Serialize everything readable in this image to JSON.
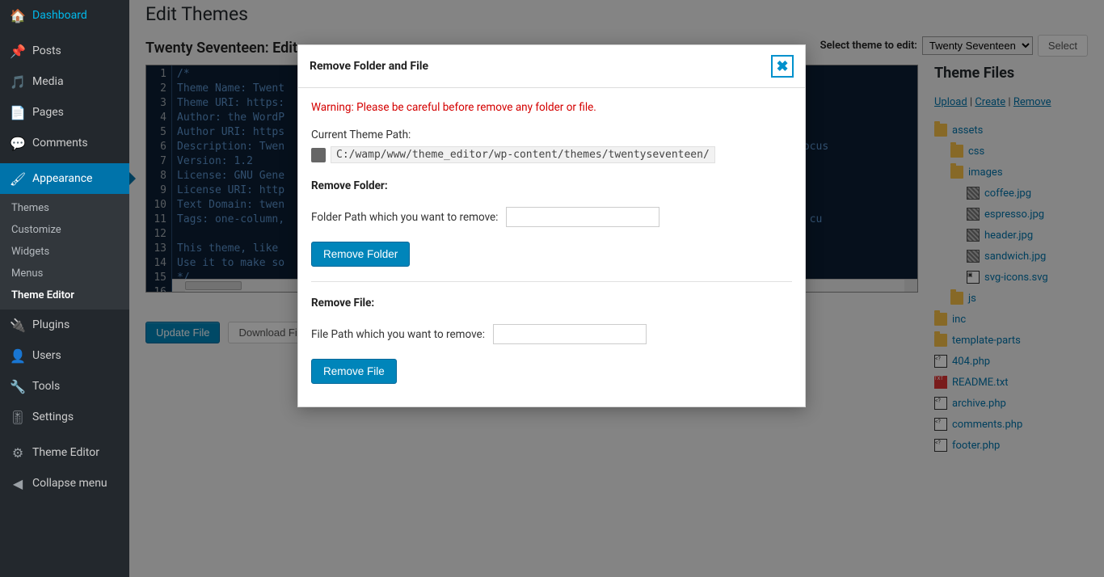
{
  "sidebar": {
    "items": [
      {
        "label": "Dashboard",
        "icon": "dashboard"
      },
      {
        "label": "Posts",
        "icon": "pin"
      },
      {
        "label": "Media",
        "icon": "media"
      },
      {
        "label": "Pages",
        "icon": "page"
      },
      {
        "label": "Comments",
        "icon": "comment"
      },
      {
        "label": "Appearance",
        "icon": "brush",
        "current": true
      },
      {
        "label": "Plugins",
        "icon": "plug"
      },
      {
        "label": "Users",
        "icon": "user"
      },
      {
        "label": "Tools",
        "icon": "wrench"
      },
      {
        "label": "Settings",
        "icon": "sliders"
      },
      {
        "label": "Theme Editor",
        "icon": "gear"
      },
      {
        "label": "Collapse menu",
        "icon": "collapse"
      }
    ],
    "appearance_sub": [
      "Themes",
      "Customize",
      "Widgets",
      "Menus",
      "Theme Editor"
    ],
    "appearance_active": "Theme Editor"
  },
  "page": {
    "title": "Edit Themes",
    "subtitle": "Twenty Seventeen: Edit",
    "select_label": "Select theme to edit:",
    "select_value": "Twenty Seventeen",
    "select_btn": "Select"
  },
  "code": {
    "lines": [
      "/*",
      "Theme Name: Twent",
      "Theme URI: https:",
      "Author: the WordP",
      "Author URI: https",
      "Description: Twen                                                                  images. With a focus",
      "Version: 1.2",
      "License: GNU Gene",
      "License URI: http",
      "Text Domain: twen",
      "Tags: one-column,                                                                  , custom-header, cu",
      "",
      "This theme, like ",
      "Use it to make so",
      "*/",
      ""
    ]
  },
  "actions": {
    "update": "Update File",
    "download": "Download File"
  },
  "files": {
    "heading": "Theme Files",
    "links": {
      "upload": "Upload",
      "create": "Create",
      "remove": "Remove",
      "sep": " | "
    },
    "tree": [
      {
        "type": "folder",
        "label": "assets",
        "indent": 0
      },
      {
        "type": "folder",
        "label": "css",
        "indent": 1
      },
      {
        "type": "folder",
        "label": "images",
        "indent": 1
      },
      {
        "type": "img",
        "label": "coffee.jpg",
        "indent": 2
      },
      {
        "type": "img",
        "label": "espresso.jpg",
        "indent": 2
      },
      {
        "type": "img",
        "label": "header.jpg",
        "indent": 2
      },
      {
        "type": "img",
        "label": "sandwich.jpg",
        "indent": 2
      },
      {
        "type": "svg",
        "label": "svg-icons.svg",
        "indent": 2
      },
      {
        "type": "folder",
        "label": "js",
        "indent": 1
      },
      {
        "type": "folder",
        "label": "inc",
        "indent": 0
      },
      {
        "type": "folder",
        "label": "template-parts",
        "indent": 0
      },
      {
        "type": "php",
        "label": "404.php",
        "indent": 0
      },
      {
        "type": "txt",
        "label": "README.txt",
        "indent": 0
      },
      {
        "type": "php",
        "label": "archive.php",
        "indent": 0
      },
      {
        "type": "php",
        "label": "comments.php",
        "indent": 0
      },
      {
        "type": "php",
        "label": "footer.php",
        "indent": 0
      }
    ]
  },
  "modal": {
    "title": "Remove Folder and File",
    "warning": "Warning: Please be careful before remove any folder or file.",
    "path_label": "Current Theme Path:",
    "path_value": "C:/wamp/www/theme_editor/wp-content/themes/twentyseventeen/",
    "folder_h": "Remove Folder:",
    "folder_label": "Folder Path which you want to remove:",
    "folder_btn": "Remove Folder",
    "file_h": "Remove File:",
    "file_label": "File Path which you want to remove:",
    "file_btn": "Remove File"
  }
}
